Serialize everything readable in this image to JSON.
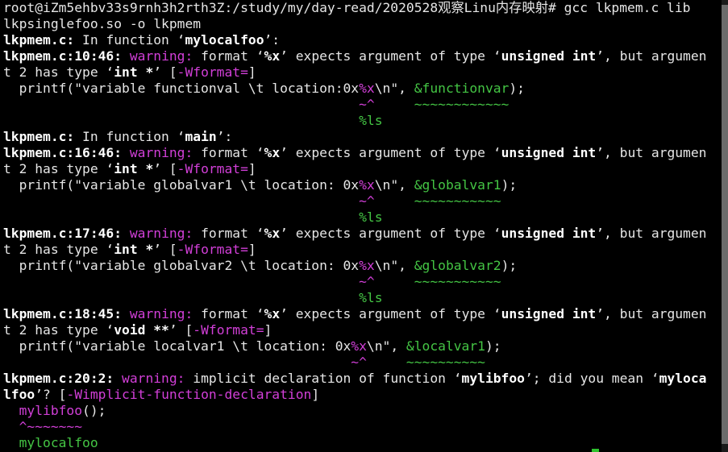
{
  "colors": {
    "background": "#000000",
    "text": "#e6e6e6",
    "warning": "#d23fd8",
    "fixit": "#44c544",
    "cursor": "#2ec22e"
  },
  "lines": [
    [
      {
        "t": "root@iZm5ehbv33s9rnh3h2rth3Z:/study/my/day-read/2020528观察Linu内存映射# gcc lkpmem.c lib"
      }
    ],
    [
      {
        "t": "lkpsinglefoo.so -o lkpmem"
      }
    ],
    [
      {
        "t": "lkpmem.c:",
        "b": 1
      },
      {
        "t": " In function ‘"
      },
      {
        "t": "mylocalfoo",
        "b": 1
      },
      {
        "t": "’:"
      }
    ],
    [
      {
        "t": "lkpmem.c:10:46:",
        "b": 1
      },
      {
        "t": " "
      },
      {
        "t": "warning:",
        "c": "w"
      },
      {
        "t": " format ‘"
      },
      {
        "t": "%x",
        "b": 1
      },
      {
        "t": "’ expects argument of type ‘"
      },
      {
        "t": "unsigned int",
        "b": 1
      },
      {
        "t": "’, but argumen"
      }
    ],
    [
      {
        "t": "t 2 has type ‘"
      },
      {
        "t": "int *",
        "b": 1
      },
      {
        "t": "’ ["
      },
      {
        "t": "-Wformat=",
        "c": "w"
      },
      {
        "t": "]"
      }
    ],
    [
      {
        "t": "  printf(\"variable functionval \\t location:0x"
      },
      {
        "t": "%x",
        "c": "w"
      },
      {
        "t": "\\n\", "
      },
      {
        "t": "&functionvar",
        "c": "g"
      },
      {
        "t": ");"
      }
    ],
    [
      {
        "t": "                                             "
      },
      {
        "t": "~^",
        "c": "w"
      },
      {
        "t": "     "
      },
      {
        "t": "~~~~~~~~~~~~",
        "c": "g"
      }
    ],
    [
      {
        "t": "                                             "
      },
      {
        "t": "%ls",
        "c": "g"
      }
    ],
    [
      {
        "t": "lkpmem.c:",
        "b": 1
      },
      {
        "t": " In function ‘"
      },
      {
        "t": "main",
        "b": 1
      },
      {
        "t": "’:"
      }
    ],
    [
      {
        "t": "lkpmem.c:16:46:",
        "b": 1
      },
      {
        "t": " "
      },
      {
        "t": "warning:",
        "c": "w"
      },
      {
        "t": " format ‘"
      },
      {
        "t": "%x",
        "b": 1
      },
      {
        "t": "’ expects argument of type ‘"
      },
      {
        "t": "unsigned int",
        "b": 1
      },
      {
        "t": "’, but argumen"
      }
    ],
    [
      {
        "t": "t 2 has type ‘"
      },
      {
        "t": "int *",
        "b": 1
      },
      {
        "t": "’ ["
      },
      {
        "t": "-Wformat=",
        "c": "w"
      },
      {
        "t": "]"
      }
    ],
    [
      {
        "t": "  printf(\"variable globalvar1 \\t location: 0x"
      },
      {
        "t": "%x",
        "c": "w"
      },
      {
        "t": "\\n\", "
      },
      {
        "t": "&globalvar1",
        "c": "g"
      },
      {
        "t": ");"
      }
    ],
    [
      {
        "t": "                                             "
      },
      {
        "t": "~^",
        "c": "w"
      },
      {
        "t": "     "
      },
      {
        "t": "~~~~~~~~~~~",
        "c": "g"
      }
    ],
    [
      {
        "t": "                                             "
      },
      {
        "t": "%ls",
        "c": "g"
      }
    ],
    [
      {
        "t": "lkpmem.c:17:46:",
        "b": 1
      },
      {
        "t": " "
      },
      {
        "t": "warning:",
        "c": "w"
      },
      {
        "t": " format ‘"
      },
      {
        "t": "%x",
        "b": 1
      },
      {
        "t": "’ expects argument of type ‘"
      },
      {
        "t": "unsigned int",
        "b": 1
      },
      {
        "t": "’, but argumen"
      }
    ],
    [
      {
        "t": "t 2 has type ‘"
      },
      {
        "t": "int *",
        "b": 1
      },
      {
        "t": "’ ["
      },
      {
        "t": "-Wformat=",
        "c": "w"
      },
      {
        "t": "]"
      }
    ],
    [
      {
        "t": "  printf(\"variable globalvar2 \\t location: 0x"
      },
      {
        "t": "%x",
        "c": "w"
      },
      {
        "t": "\\n\", "
      },
      {
        "t": "&globalvar2",
        "c": "g"
      },
      {
        "t": ");"
      }
    ],
    [
      {
        "t": "                                             "
      },
      {
        "t": "~^",
        "c": "w"
      },
      {
        "t": "     "
      },
      {
        "t": "~~~~~~~~~~~",
        "c": "g"
      }
    ],
    [
      {
        "t": "                                             "
      },
      {
        "t": "%ls",
        "c": "g"
      }
    ],
    [
      {
        "t": "lkpmem.c:18:45:",
        "b": 1
      },
      {
        "t": " "
      },
      {
        "t": "warning:",
        "c": "w"
      },
      {
        "t": " format ‘"
      },
      {
        "t": "%x",
        "b": 1
      },
      {
        "t": "’ expects argument of type ‘"
      },
      {
        "t": "unsigned int",
        "b": 1
      },
      {
        "t": "’, but argumen"
      }
    ],
    [
      {
        "t": "t 2 has type ‘"
      },
      {
        "t": "void **",
        "b": 1
      },
      {
        "t": "’ ["
      },
      {
        "t": "-Wformat=",
        "c": "w"
      },
      {
        "t": "]"
      }
    ],
    [
      {
        "t": "  printf(\"variable localvar1 \\t location: 0x"
      },
      {
        "t": "%x",
        "c": "w"
      },
      {
        "t": "\\n\", "
      },
      {
        "t": "&localvar1",
        "c": "g"
      },
      {
        "t": ");"
      }
    ],
    [
      {
        "t": "                                            "
      },
      {
        "t": "~^",
        "c": "w"
      },
      {
        "t": "     "
      },
      {
        "t": "~~~~~~~~~~",
        "c": "g"
      }
    ],
    [
      {
        "t": "lkpmem.c:20:2:",
        "b": 1
      },
      {
        "t": " "
      },
      {
        "t": "warning:",
        "c": "w"
      },
      {
        "t": " implicit declaration of function ‘"
      },
      {
        "t": "mylibfoo",
        "b": 1
      },
      {
        "t": "’; did you mean ‘"
      },
      {
        "t": "myloca",
        "b": 1
      }
    ],
    [
      {
        "t": "lfoo",
        "b": 1
      },
      {
        "t": "’? ["
      },
      {
        "t": "-Wimplicit-function-declaration",
        "c": "w"
      },
      {
        "t": "]"
      }
    ],
    [
      {
        "t": "  "
      },
      {
        "t": "mylibfoo",
        "c": "w"
      },
      {
        "t": "();"
      }
    ],
    [
      {
        "t": "  "
      },
      {
        "t": "^~~~~~~~",
        "c": "w"
      }
    ],
    [
      {
        "t": "  "
      },
      {
        "t": "mylocalfoo",
        "c": "g"
      }
    ]
  ]
}
